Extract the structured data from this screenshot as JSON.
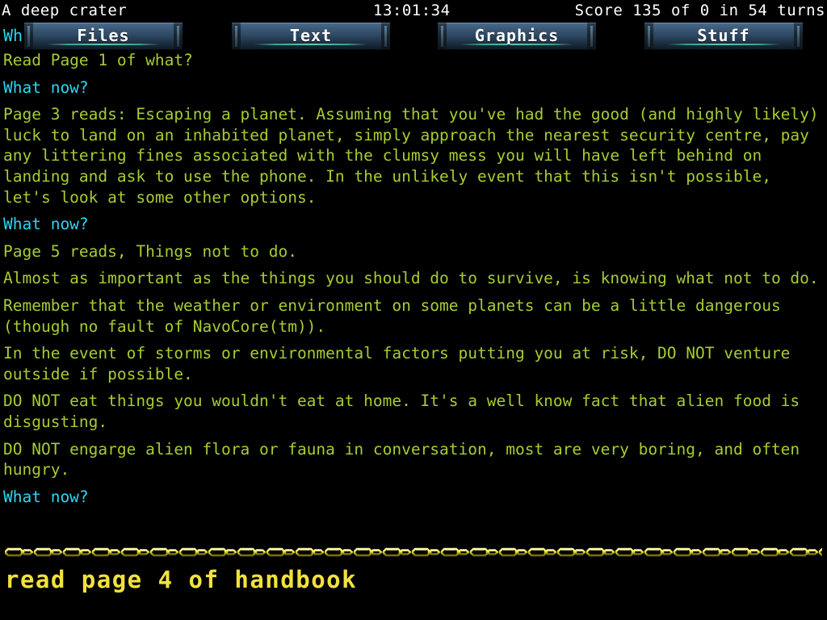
{
  "status_bar": {
    "location": "A deep crater",
    "time": "13:01:34",
    "score": "Score 135 of 0 in 54 turns"
  },
  "menu_bar": {
    "peek_text": "Wh",
    "items": [
      {
        "label": "Files"
      },
      {
        "label": "Text"
      },
      {
        "label": "Graphics"
      },
      {
        "label": "Stuff"
      }
    ]
  },
  "colors": {
    "background": "#000000",
    "status_text": "#ffffff",
    "game_text": "#a6cc33",
    "prompt_text": "#2ad8f0",
    "input_text": "#f2e23c",
    "divider_chain": "#e8e03a",
    "button_accent": "#63c7ad"
  },
  "transcript": [
    {
      "style": "output",
      "text": "Read Page 1 of what?"
    },
    {
      "style": "prompt",
      "text": "What now?"
    },
    {
      "style": "output",
      "text": "Page 3 reads: Escaping a planet. Assuming that you've had the good (and highly likely) luck to land on an inhabited planet, simply approach the nearest security centre, pay any littering fines associated with the clumsy mess you will have left behind on landing and ask to use the phone. In the unlikely event that this isn't possible, let's look at some other options."
    },
    {
      "style": "prompt",
      "text": "What now?"
    },
    {
      "style": "output",
      "text": "Page 5 reads, Things not to do."
    },
    {
      "style": "output",
      "text": "Almost as important as the things you should do to survive, is knowing what not to do."
    },
    {
      "style": "output",
      "text": "Remember that the weather or environment on some planets can be a little dangerous (though no fault of NavoCore(tm))."
    },
    {
      "style": "output",
      "text": "In the event of storms or environmental factors putting you at risk, DO NOT venture outside if possible."
    },
    {
      "style": "output",
      "text": "DO NOT eat things you wouldn't eat at home. It's a well know fact that alien food is disgusting."
    },
    {
      "style": "output",
      "text": "DO NOT engarge alien flora or fauna in conversation, most are very boring, and often hungry."
    },
    {
      "style": "prompt",
      "text": "What now?"
    }
  ],
  "command_input": {
    "value": "read page 4 of handbook",
    "placeholder": ""
  }
}
